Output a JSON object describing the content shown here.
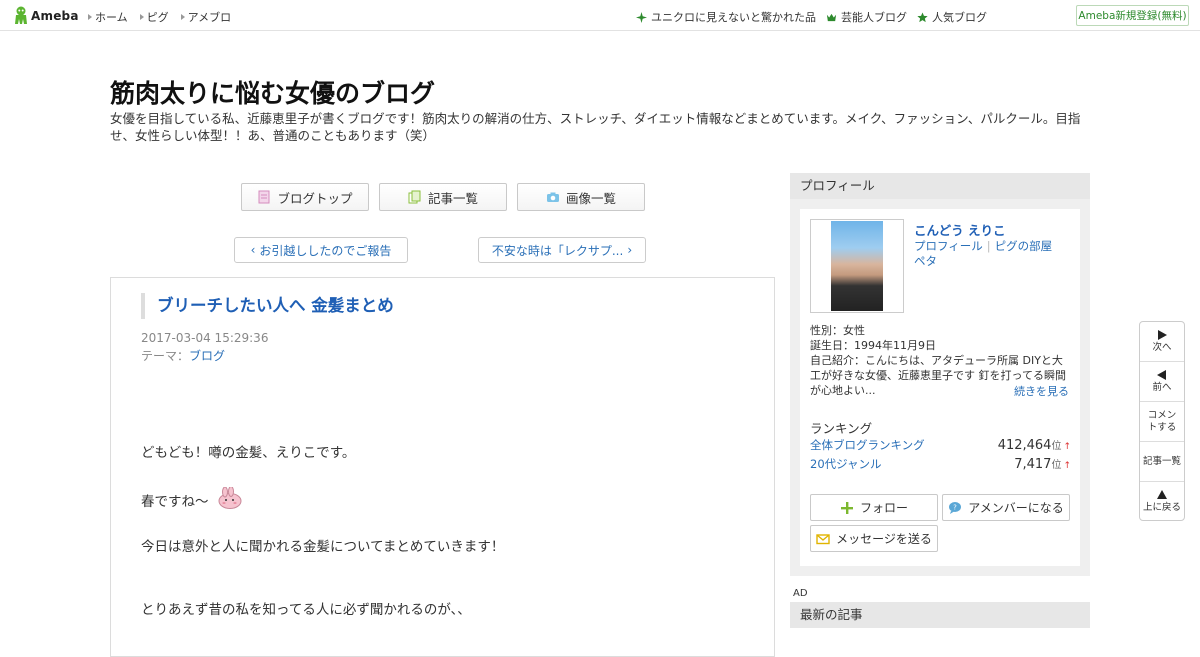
{
  "topbar": {
    "logo_text": "Ameba",
    "nav": [
      "ホーム",
      "ピグ",
      "アメブロ"
    ],
    "links": [
      {
        "label": "ユニクロに見えないと驚かれた品",
        "icon": "sparkle-icon"
      },
      {
        "label": "芸能人ブログ",
        "icon": "crown-icon"
      },
      {
        "label": "人気ブログ",
        "icon": "star-icon"
      }
    ],
    "signup": "Ameba新規登録(無料)",
    "accent": "#2d8a2d"
  },
  "header": {
    "title": "筋肉太りに悩む女優のブログ",
    "description": "女優を目指している私、近藤恵里子が書くブログです！筋肉太りの解消の仕方、ストレッチ、ダイエット情報などまとめています。メイク、ファッション、パルクール。目指せ、女性らしい体型！！あ、普通のこともあります（笑）"
  },
  "blog_nav": {
    "top": "ブログトップ",
    "list": "記事一覧",
    "images": "画像一覧"
  },
  "pager": {
    "prev": "お引越ししたのでご報告",
    "next": "不安な時は「レクサプ..."
  },
  "entry": {
    "title": "ブリーチしたい人へ 金髪まとめ",
    "date": "2017-03-04 15:29:36",
    "theme_label": "テーマ：",
    "theme": "ブログ",
    "paragraphs": [
      "どもども！噂の金髪、えりこです。",
      "春ですね〜",
      "今日は意外と人に聞かれる金髪についてまとめていきます！",
      "とりあえず昔の私を知ってる人に必ず聞かれるのが、、"
    ]
  },
  "sidebar": {
    "profile_heading": "プロフィール",
    "name": "こんどう えりこ",
    "links": [
      "プロフィール",
      "ピグの部屋",
      "ペタ"
    ],
    "gender": "性別：女性",
    "birthday": "誕生日：1994年11月9日",
    "intro": "自己紹介：こんにちは、アタデューラ所属 DIYと大工が好きな女優、近藤恵里子です 釘を打ってる瞬間が心地よい...",
    "more": "続きを見る",
    "ranking_heading": "ランキング",
    "rankings": [
      {
        "label": "全体ブログランキング",
        "value": "412,464",
        "unit": "位",
        "arrow": "↑"
      },
      {
        "label": "20代ジャンル",
        "value": "7,417",
        "unit": "位",
        "arrow": "↑"
      }
    ],
    "follow": "フォロー",
    "amember": "アメンバーになる",
    "message": "メッセージを送る",
    "ad": "AD",
    "recent_heading": "最新の記事"
  },
  "floatnav": {
    "next": "次へ",
    "prev": "前へ",
    "comment": "コメントする",
    "list": "記事一覧",
    "top": "上に戻る"
  }
}
